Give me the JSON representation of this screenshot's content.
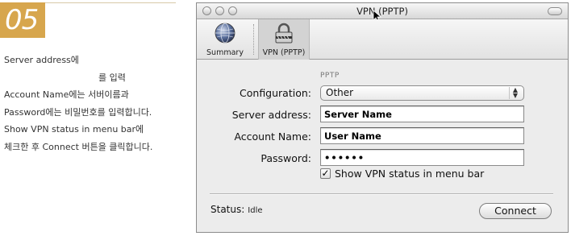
{
  "step": {
    "number": "05"
  },
  "instructions": [
    "Server address에",
    "를 입력",
    "Account Name에는 서버이름과",
    "Password에는 비밀번호를 입력합니다.",
    "Show VPN status in menu bar에",
    "체크한 후 Connect 버튼을 클릭합니다."
  ],
  "window": {
    "title": "VPN (PPTP)",
    "toolbar": [
      {
        "label": "Summary",
        "icon": "globe-icon"
      },
      {
        "label": "VPN (PPTP)",
        "icon": "lock-icon",
        "selected": true
      }
    ]
  },
  "form": {
    "group_label": "PPTP",
    "configuration": {
      "label": "Configuration:",
      "value": "Other"
    },
    "server_address": {
      "label": "Server address:",
      "value": "Server Name"
    },
    "account_name": {
      "label": "Account Name:",
      "value": "User Name"
    },
    "password": {
      "label": "Password:",
      "value": "••••••"
    },
    "show_status": {
      "label": "Show VPN status in menu bar",
      "checked": true
    }
  },
  "status": {
    "label": "Status:",
    "value": "Idle"
  },
  "connect_button": {
    "label": "Connect"
  },
  "colors": {
    "badge": "#d7a64d",
    "window_bg": "#ececec"
  }
}
